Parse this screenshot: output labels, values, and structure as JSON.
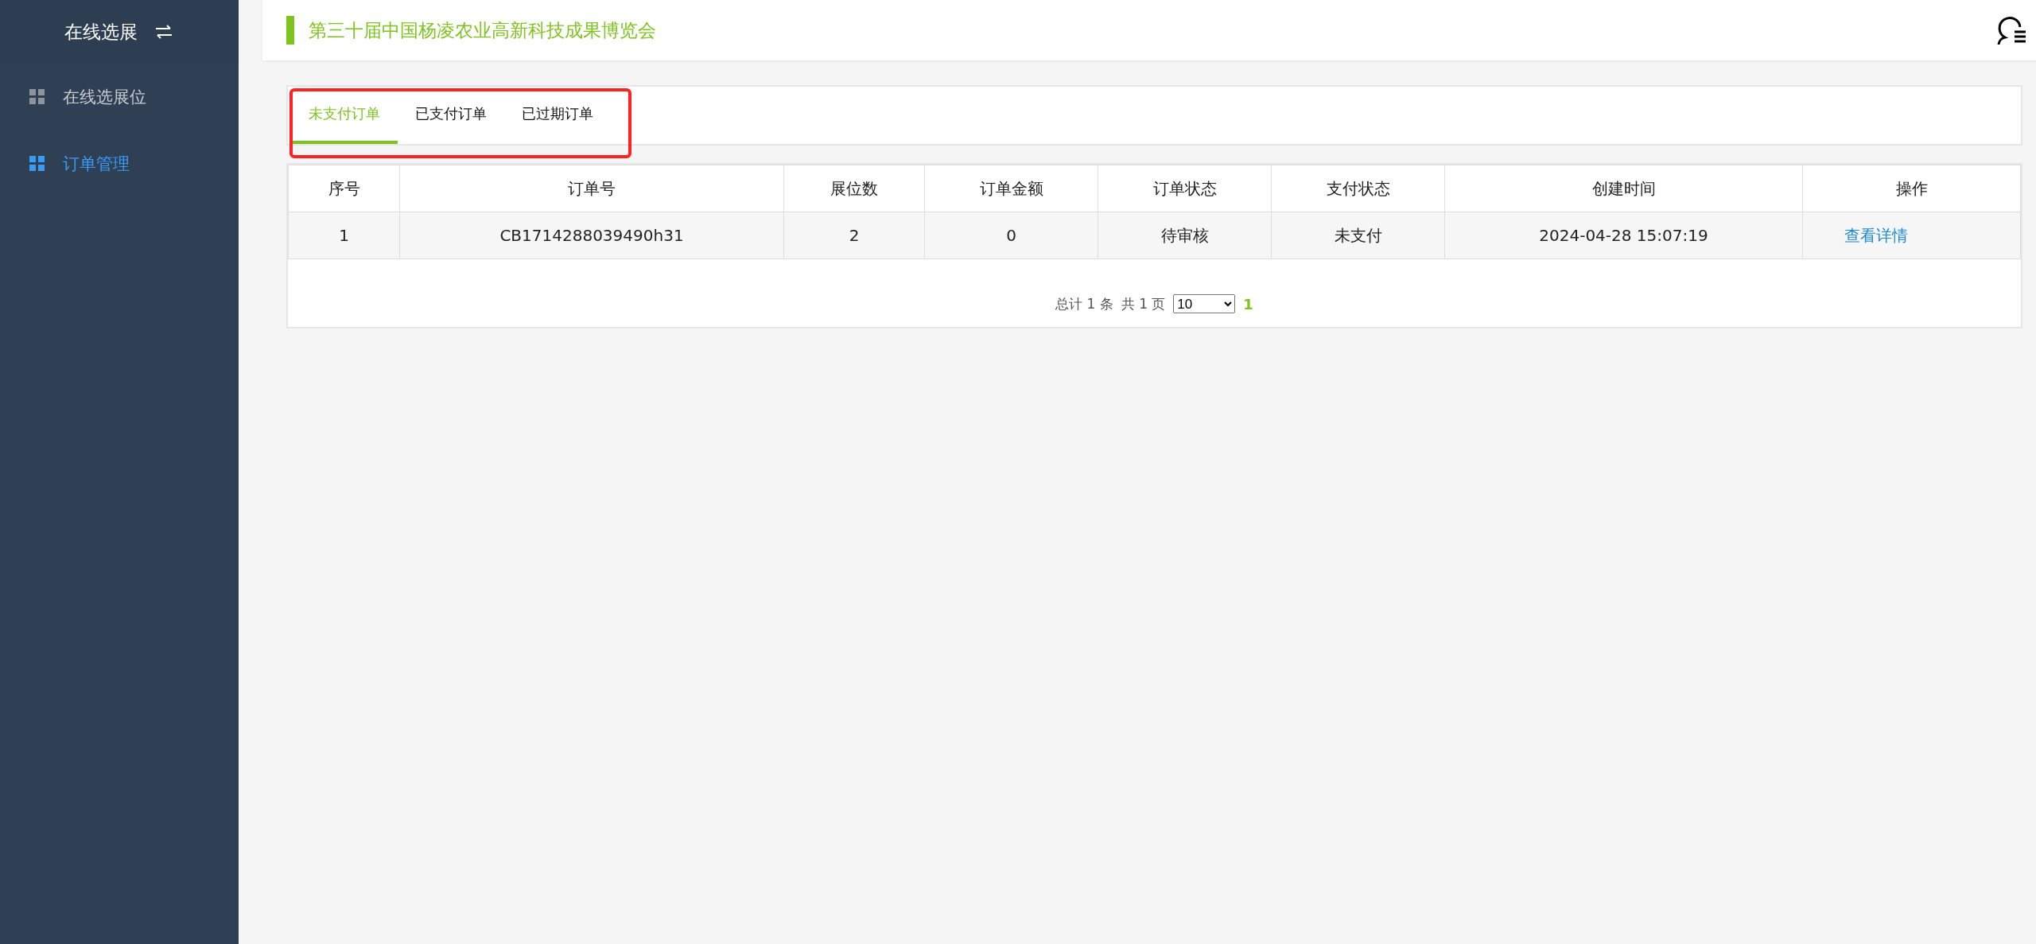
{
  "sidebar": {
    "title": "在线选展",
    "items": [
      {
        "label": "在线选展位",
        "selected": false
      },
      {
        "label": "订单管理",
        "selected": true
      }
    ]
  },
  "header": {
    "title": "第三十届中国杨凌农业高新科技成果博览会"
  },
  "tabs": [
    {
      "label": "未支付订单",
      "selected": true
    },
    {
      "label": "已支付订单",
      "selected": false
    },
    {
      "label": "已过期订单",
      "selected": false
    }
  ],
  "table": {
    "columns": [
      "序号",
      "订单号",
      "展位数",
      "订单金额",
      "订单状态",
      "支付状态",
      "创建时间",
      "操作"
    ],
    "rows": [
      {
        "cells": [
          "1",
          "CB1714288039490h31",
          "2",
          "0",
          "待审核",
          "未支付",
          "2024-04-28 15:07:19"
        ],
        "action": "查看详情"
      }
    ]
  },
  "pagination": {
    "total_prefix": "总计",
    "total": "1",
    "total_suffix": "条",
    "pages_prefix": "共",
    "pages": "1",
    "pages_suffix": "页",
    "page_size": "10",
    "current_page": "1"
  }
}
